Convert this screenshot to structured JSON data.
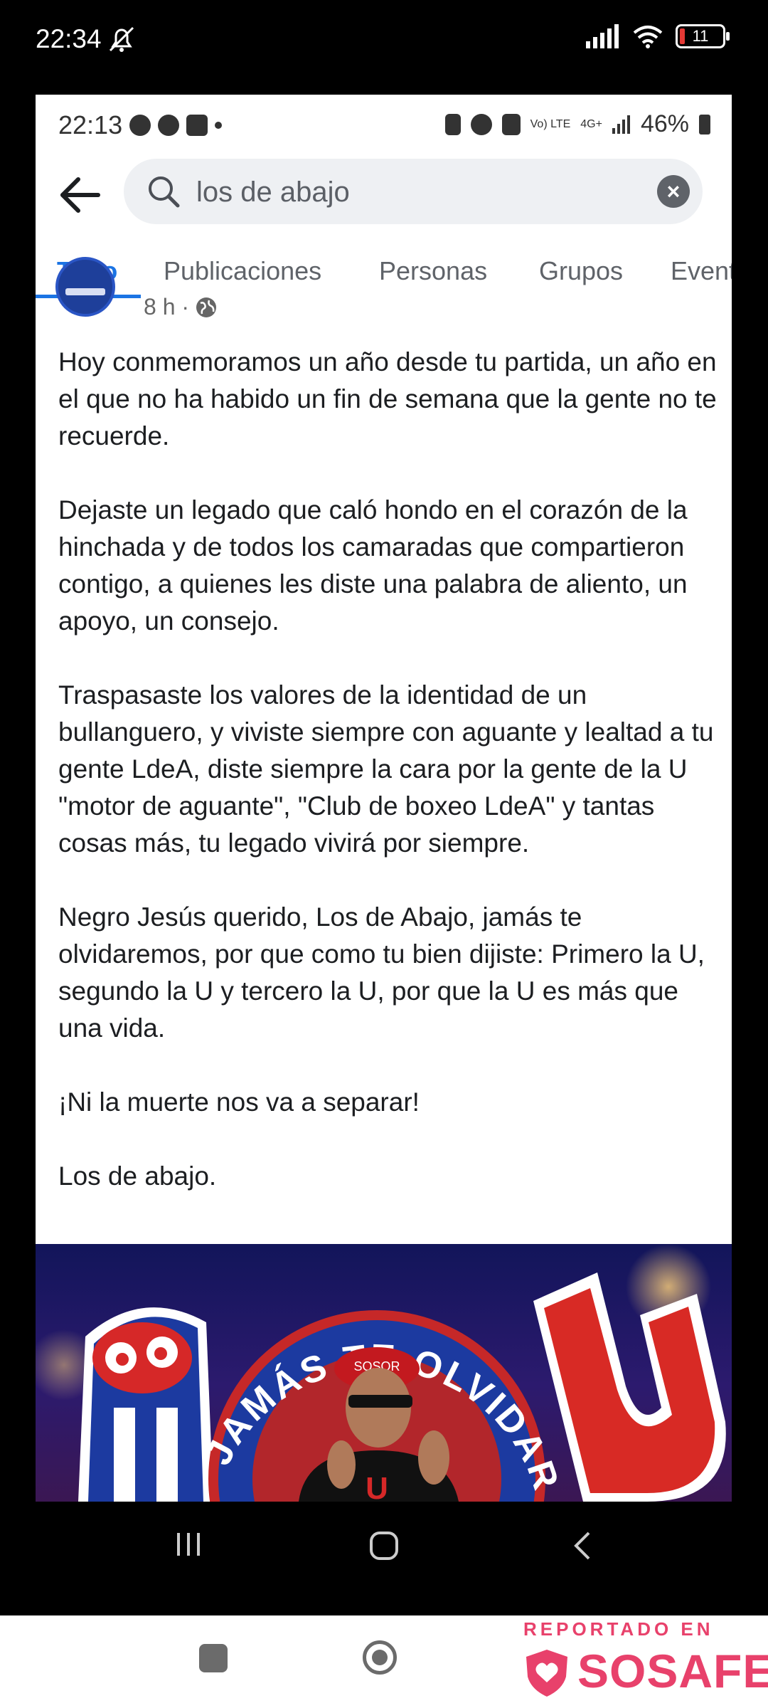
{
  "outer_status": {
    "time": "22:34",
    "battery": "11"
  },
  "inner_status": {
    "time": "22:13",
    "right_text": "46%",
    "volte": "Vo) LTE",
    "net": "4G+"
  },
  "search": {
    "query": "los de abajo"
  },
  "tabs": [
    {
      "label": "Todo",
      "active": true
    },
    {
      "label": "Publicaciones"
    },
    {
      "label": "Personas"
    },
    {
      "label": "Grupos"
    },
    {
      "label": "Event"
    }
  ],
  "post": {
    "time": "8 h ·",
    "paragraphs": [
      "Hoy conmemoramos un año desde tu partida, un año en el que no ha habido un fin de semana que la gente no te recuerde.",
      "Dejaste un legado que caló hondo en el corazón de la hinchada y de todos los camaradas que compartieron contigo, a quienes les diste una palabra de aliento, un apoyo, un consejo.",
      "Traspasaste los valores de la identidad de un bullanguero, y viviste siempre con aguante y lealtad a tu gente LdeA, diste siempre la cara por la gente de la U \"motor de aguante\", \"Club de boxeo LdeA\" y tantas cosas más, tu legado vivirá por siempre.",
      "Negro Jesús querido, Los de Abajo, jamás te olvidaremos, por que como tu bien dijiste: Primero la U, segundo la U y tercero la U,  por que la U es más que una vida.",
      "¡Ni la muerte nos va a separar!",
      "Los de abajo."
    ],
    "image": {
      "banner_text": "JESUS JAMÁS TE OLVIDAREMOS",
      "letter": "U",
      "cap_text": "SOSOR"
    }
  },
  "watermark": {
    "reported": "REPORTADO EN",
    "brand": "SOSAFE"
  },
  "colors": {
    "accent": "#1b74e4",
    "brand": "#e8416b"
  }
}
